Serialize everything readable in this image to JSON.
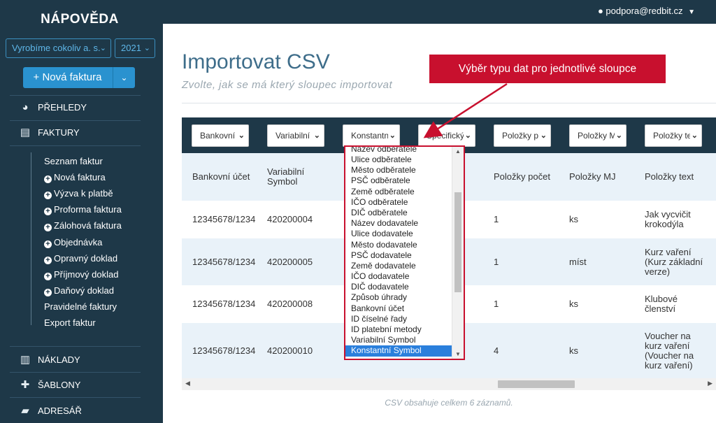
{
  "sidebar": {
    "title": "NÁPOVĚDA",
    "company_select": "Vyrobíme cokoliv a. s.",
    "year_select": "2021",
    "new_invoice_button": "+ Nová faktura",
    "sections": {
      "overview": "PŘEHLEDY",
      "invoices": "FAKTURY",
      "costs": "NÁKLADY",
      "templates": "ŠABLONY",
      "addresses": "ADRESÁŘ"
    },
    "invoice_items": [
      {
        "label": "Seznam faktur",
        "plus": false
      },
      {
        "label": "Nová faktura",
        "plus": true
      },
      {
        "label": "Výzva k platbě",
        "plus": true
      },
      {
        "label": "Proforma faktura",
        "plus": true
      },
      {
        "label": "Zálohová faktura",
        "plus": true
      },
      {
        "label": "Objednávka",
        "plus": true
      },
      {
        "label": "Opravný doklad",
        "plus": true
      },
      {
        "label": "Příjmový doklad",
        "plus": true
      },
      {
        "label": "Daňový doklad",
        "plus": true
      },
      {
        "label": "Pravidelné faktury",
        "plus": false
      },
      {
        "label": "Export faktur",
        "plus": false
      }
    ]
  },
  "topbar": {
    "user_email": "podpora@redbit.cz"
  },
  "main": {
    "title": "Importovat CSV",
    "subtitle": "Zvolte, jak se má který sloupec importovat",
    "callout": "Výběr typu dat pro jednotlivé sloupce",
    "column_selects": [
      "Bankovní",
      "Variabilní",
      "Konstantn",
      "Specifický",
      "Položky p",
      "Položky M",
      "Položky te"
    ],
    "column_headers": {
      "c0": "Bankovní účet",
      "c1": "Variabilní Symbol",
      "c4": "Položky počet",
      "c5": "Položky MJ",
      "c6": "Položky text"
    },
    "rows": [
      {
        "c0": "12345678/1234",
        "c1": "420200004",
        "c4": "1",
        "c5": "ks",
        "c6": "Jak vycvičit krokodýla"
      },
      {
        "c0": "12345678/1234",
        "c1": "420200005",
        "c4": "1",
        "c5": "míst",
        "c6": "Kurz vaření (Kurz základní verze)"
      },
      {
        "c0": "12345678/1234",
        "c1": "420200008",
        "c4": "1",
        "c5": "ks",
        "c6": "Klubové členství"
      },
      {
        "c0": "12345678/1234",
        "c1": "420200010",
        "c4": "4",
        "c5": "ks",
        "c6": "Voucher na kurz vaření (Voucher na kurz vaření)"
      }
    ],
    "footer_note": "CSV obsahuje celkem 6 záznamů."
  },
  "dropdown": {
    "items": [
      "Název odběratele",
      "Ulice odběratele",
      "Město odběratele",
      "PSČ odběratele",
      "Země odběratele",
      "IČO odběratele",
      "DIČ odběratele",
      "Název dodavatele",
      "Ulice dodavatele",
      "Město dodavatele",
      "PSČ dodavatele",
      "Země dodavatele",
      "IČO dodavatele",
      "DIČ dodavatele",
      "Způsob úhrady",
      "Bankovní účet",
      "ID číselné řady",
      "ID platební metody",
      "Variabilní Symbol",
      "Konstantní Symbol"
    ],
    "selected": "Konstantní Symbol"
  },
  "colors": {
    "sidebar_bg": "#1e3848",
    "accent": "#2a92cf",
    "callout": "#c8102e",
    "row_alt": "#e9f2f9"
  }
}
